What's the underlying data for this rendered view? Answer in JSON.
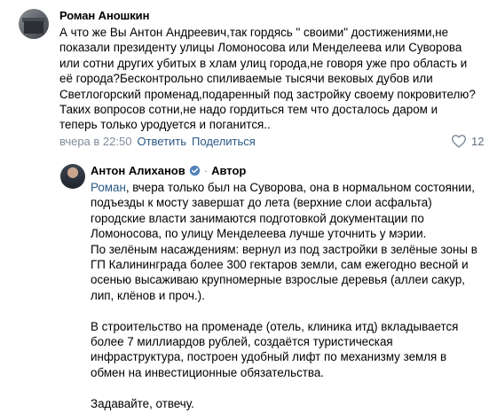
{
  "comment": {
    "author": "Роман Аношкин",
    "text": "А что же Вы Антон Андреевич,так гордясь \" своими\" достижениями,не показали президенту улицы Ломоносова или Менделеева или Суворова или сотни других убитых в хлам улиц города,не говоря уже про область и её города?Бесконтрольно спиливаемые тысячи вековых дубов или Светлогорский променад,подаренный под застройку своему покровителю? Таких вопросов сотни,не надо гордиться тем что досталось даром и теперь только уродуется и поганится..",
    "time": "вчера в 22:50",
    "reply_label": "Ответить",
    "share_label": "Поделиться",
    "likes": "12"
  },
  "reply": {
    "author": "Антон Алиханов",
    "author_tag": "Автор",
    "mention": "Роман",
    "p1_rest": ", вчера только был на Суворова, она в нормальном состоянии, подъезды к мосту завершат до лета (верхние слои асфальта) городские власти занимаются подготовкой документации по Ломоносова, по улицу Менделеева лучше уточнить у мэрии.",
    "p2": "По зелёным насаждениям: вернул из под застройки в зелёные зоны в ГП Калининграда более 300 гектаров земли, сам ежегодно весной и осенью высаживаю крупномерные взрослые деревья (аллеи сакур, лип, клёнов и проч.).",
    "p3": "В строительство на променаде (отель, клиника итд) вкладывается более 7 миллиардов рублей, создаётся туристическая инфраструктура, построен удобный лифт по механизму земля в обмен на инвестиционные обязательства.",
    "p4": "Задавайте, отвечу."
  },
  "colors": {
    "link": "#2a5885",
    "meta": "#818c99",
    "verified": "#5181b8"
  }
}
